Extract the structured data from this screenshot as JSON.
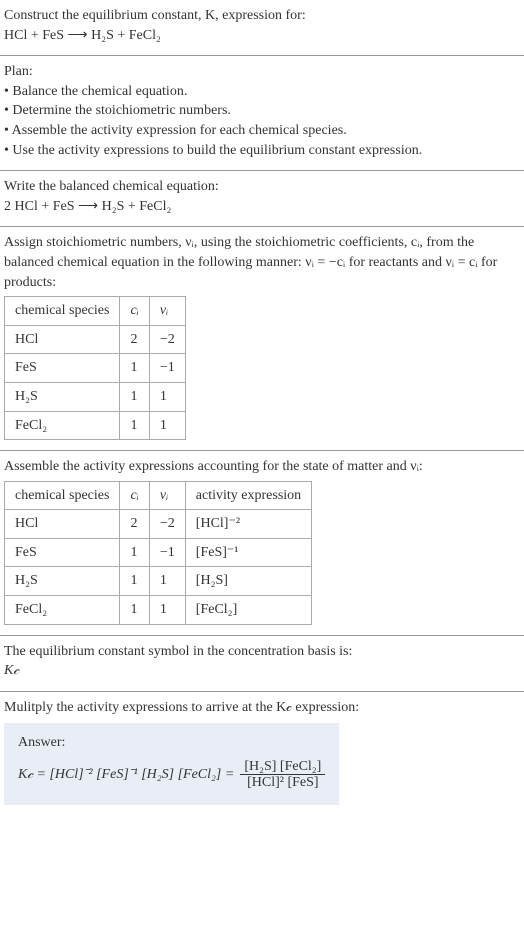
{
  "s1": {
    "l1": "Construct the equilibrium constant, K, expression for:",
    "l2": "HCl + FeS  ⟶  H₂S + FeCl₂"
  },
  "s2": {
    "h": "Plan:",
    "b1": "• Balance the chemical equation.",
    "b2": "• Determine the stoichiometric numbers.",
    "b3": "• Assemble the activity expression for each chemical species.",
    "b4": "• Use the activity expressions to build the equilibrium constant expression."
  },
  "s3": {
    "l1": "Write the balanced chemical equation:",
    "l2": "2 HCl + FeS  ⟶  H₂S + FeCl₂"
  },
  "s4": {
    "p1": "Assign stoichiometric numbers, νᵢ, using the stoichiometric coefficients, cᵢ, from the balanced chemical equation in the following manner: νᵢ = −cᵢ for reactants and νᵢ = cᵢ for products:",
    "h1": "chemical species",
    "h2": "cᵢ",
    "h3": "νᵢ",
    "r1c1": "HCl",
    "r1c2": "2",
    "r1c3": "−2",
    "r2c1": "FeS",
    "r2c2": "1",
    "r2c3": "−1",
    "r3c1": "H₂S",
    "r3c2": "1",
    "r3c3": "1",
    "r4c1": "FeCl₂",
    "r4c2": "1",
    "r4c3": "1"
  },
  "s5": {
    "p1": "Assemble the activity expressions accounting for the state of matter and νᵢ:",
    "h1": "chemical species",
    "h2": "cᵢ",
    "h3": "νᵢ",
    "h4": "activity expression",
    "r1c1": "HCl",
    "r1c2": "2",
    "r1c3": "−2",
    "r1c4": "[HCl]⁻²",
    "r2c1": "FeS",
    "r2c2": "1",
    "r2c3": "−1",
    "r2c4": "[FeS]⁻¹",
    "r3c1": "H₂S",
    "r3c2": "1",
    "r3c3": "1",
    "r3c4": "[H₂S]",
    "r4c1": "FeCl₂",
    "r4c2": "1",
    "r4c3": "1",
    "r4c4": "[FeCl₂]"
  },
  "s6": {
    "l1": "The equilibrium constant symbol in the concentration basis is:",
    "l2": "K𝒸"
  },
  "s7": {
    "l1": "Mulitply the activity expressions to arrive at the K𝒸 expression:"
  },
  "ans": {
    "label": "Answer:",
    "lhs": "K𝒸 = [HCl]⁻² [FeS]⁻¹ [H₂S] [FeCl₂] =",
    "num": "[H₂S] [FeCl₂]",
    "den": "[HCl]² [FeS]"
  },
  "chart_data": {
    "type": "table",
    "tables": [
      {
        "title": "Stoichiometric numbers",
        "columns": [
          "chemical species",
          "cᵢ",
          "νᵢ"
        ],
        "rows": [
          [
            "HCl",
            2,
            -2
          ],
          [
            "FeS",
            1,
            -1
          ],
          [
            "H₂S",
            1,
            1
          ],
          [
            "FeCl₂",
            1,
            1
          ]
        ]
      },
      {
        "title": "Activity expressions",
        "columns": [
          "chemical species",
          "cᵢ",
          "νᵢ",
          "activity expression"
        ],
        "rows": [
          [
            "HCl",
            2,
            -2,
            "[HCl]^-2"
          ],
          [
            "FeS",
            1,
            -1,
            "[FeS]^-1"
          ],
          [
            "H₂S",
            1,
            1,
            "[H₂S]"
          ],
          [
            "FeCl₂",
            1,
            1,
            "[FeCl₂]"
          ]
        ]
      }
    ],
    "balanced_equation": "2 HCl + FeS ⟶ H₂S + FeCl₂",
    "Kc_expression": "[H₂S][FeCl₂] / ([HCl]^2 [FeS])"
  }
}
